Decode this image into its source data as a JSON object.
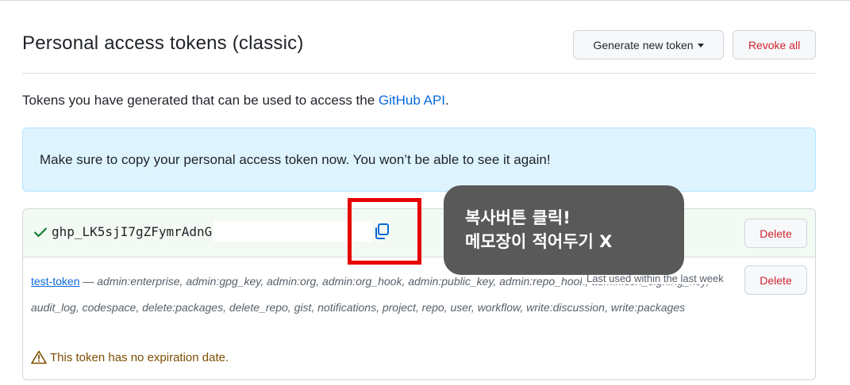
{
  "header": {
    "title": "Personal access tokens (classic)",
    "generate_label": "Generate new token",
    "revoke_label": "Revoke all"
  },
  "intro": {
    "text": "Tokens you have generated that can be used to access the ",
    "link": "GitHub API",
    "suffix": "."
  },
  "flash": {
    "message": "Make sure to copy your personal access token now. You won’t be able to see it again!"
  },
  "new_token": {
    "value": "ghp_LK5sjI7gZFymrAdnG",
    "delete_label": "Delete"
  },
  "token": {
    "name": "test-token",
    "separator": " — ",
    "scopes": "admin:enterprise, admin:gpg_key, admin:org, admin:org_hook, admin:public_key, admin:repo_hook, admin:ssh_signing_key, audit_log, codespace, delete:packages, delete_repo, gist, notifications, project, repo, user, workflow, write:discussion, write:packages",
    "last_used": "Last used within the last week",
    "delete_label": "Delete",
    "expiry": "This token has no expiration date."
  },
  "annotation": {
    "line1": "복사버튼 클릭!",
    "line2": "메모장이 적어두기 X"
  },
  "colors": {
    "link": "#0969da",
    "danger": "#cf222e",
    "success": "#1a7f37",
    "flash_bg": "#ddf4ff",
    "annotation_red": "#e60000",
    "bubble_bg": "#595959"
  },
  "icons": [
    "check-icon",
    "copy-icon",
    "caret-down-icon",
    "alert-icon"
  ]
}
